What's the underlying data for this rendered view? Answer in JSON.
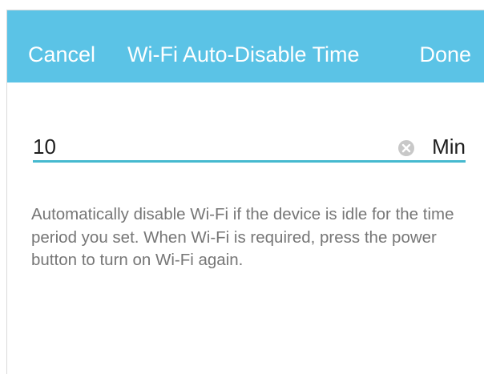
{
  "navbar": {
    "cancel_label": "Cancel",
    "title": "Wi-Fi Auto-Disable Time",
    "done_label": "Done"
  },
  "field": {
    "value": "10",
    "unit": "Min",
    "clear_icon": "clear-circle-x-icon"
  },
  "description": "Automatically disable Wi-Fi if the device is idle for the time period you set. When Wi-Fi is required, press the power button to turn on Wi-Fi again.",
  "colors": {
    "navbar_background": "#5bc3e6",
    "navbar_text": "#ffffff",
    "input_underline": "#45b9cf",
    "description_text": "#767676"
  }
}
